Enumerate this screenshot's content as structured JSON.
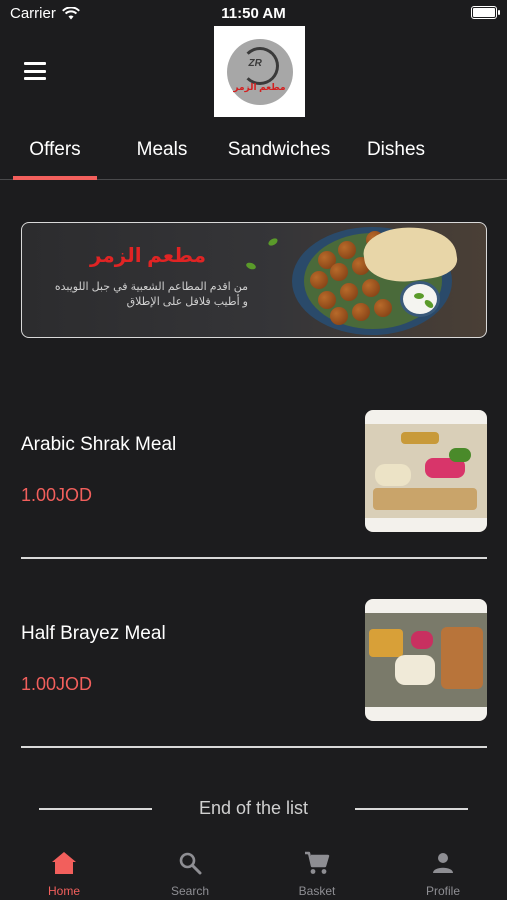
{
  "status_bar": {
    "carrier": "Carrier",
    "time": "11:50 AM"
  },
  "header": {
    "logo_initials": "ZR",
    "logo_text": "مطعم الزمر"
  },
  "tabs": [
    {
      "label": "Offers",
      "active": true
    },
    {
      "label": "Meals",
      "active": false
    },
    {
      "label": "Sandwiches",
      "active": false
    },
    {
      "label": "Dishes",
      "active": false
    }
  ],
  "banner": {
    "title": "مطعم الزمر",
    "line1": "من اقدم المطاعم الشعبية في جبل اللويبده",
    "line2": "و أطيب فلافل على الإطلاق"
  },
  "meals": [
    {
      "name": "Arabic Shrak Meal",
      "price": "1.00JOD"
    },
    {
      "name": "Half Brayez Meal",
      "price": "1.00JOD"
    }
  ],
  "list_end": "End of the list",
  "bottom_nav": [
    {
      "label": "Home",
      "icon": "home-icon",
      "active": true
    },
    {
      "label": "Search",
      "icon": "search-icon",
      "active": false
    },
    {
      "label": "Basket",
      "icon": "cart-icon",
      "active": false
    },
    {
      "label": "Profile",
      "icon": "person-icon",
      "active": false
    }
  ],
  "colors": {
    "accent": "#f25f5c",
    "background": "#1c1c1e",
    "inactive": "#8e8e93"
  }
}
